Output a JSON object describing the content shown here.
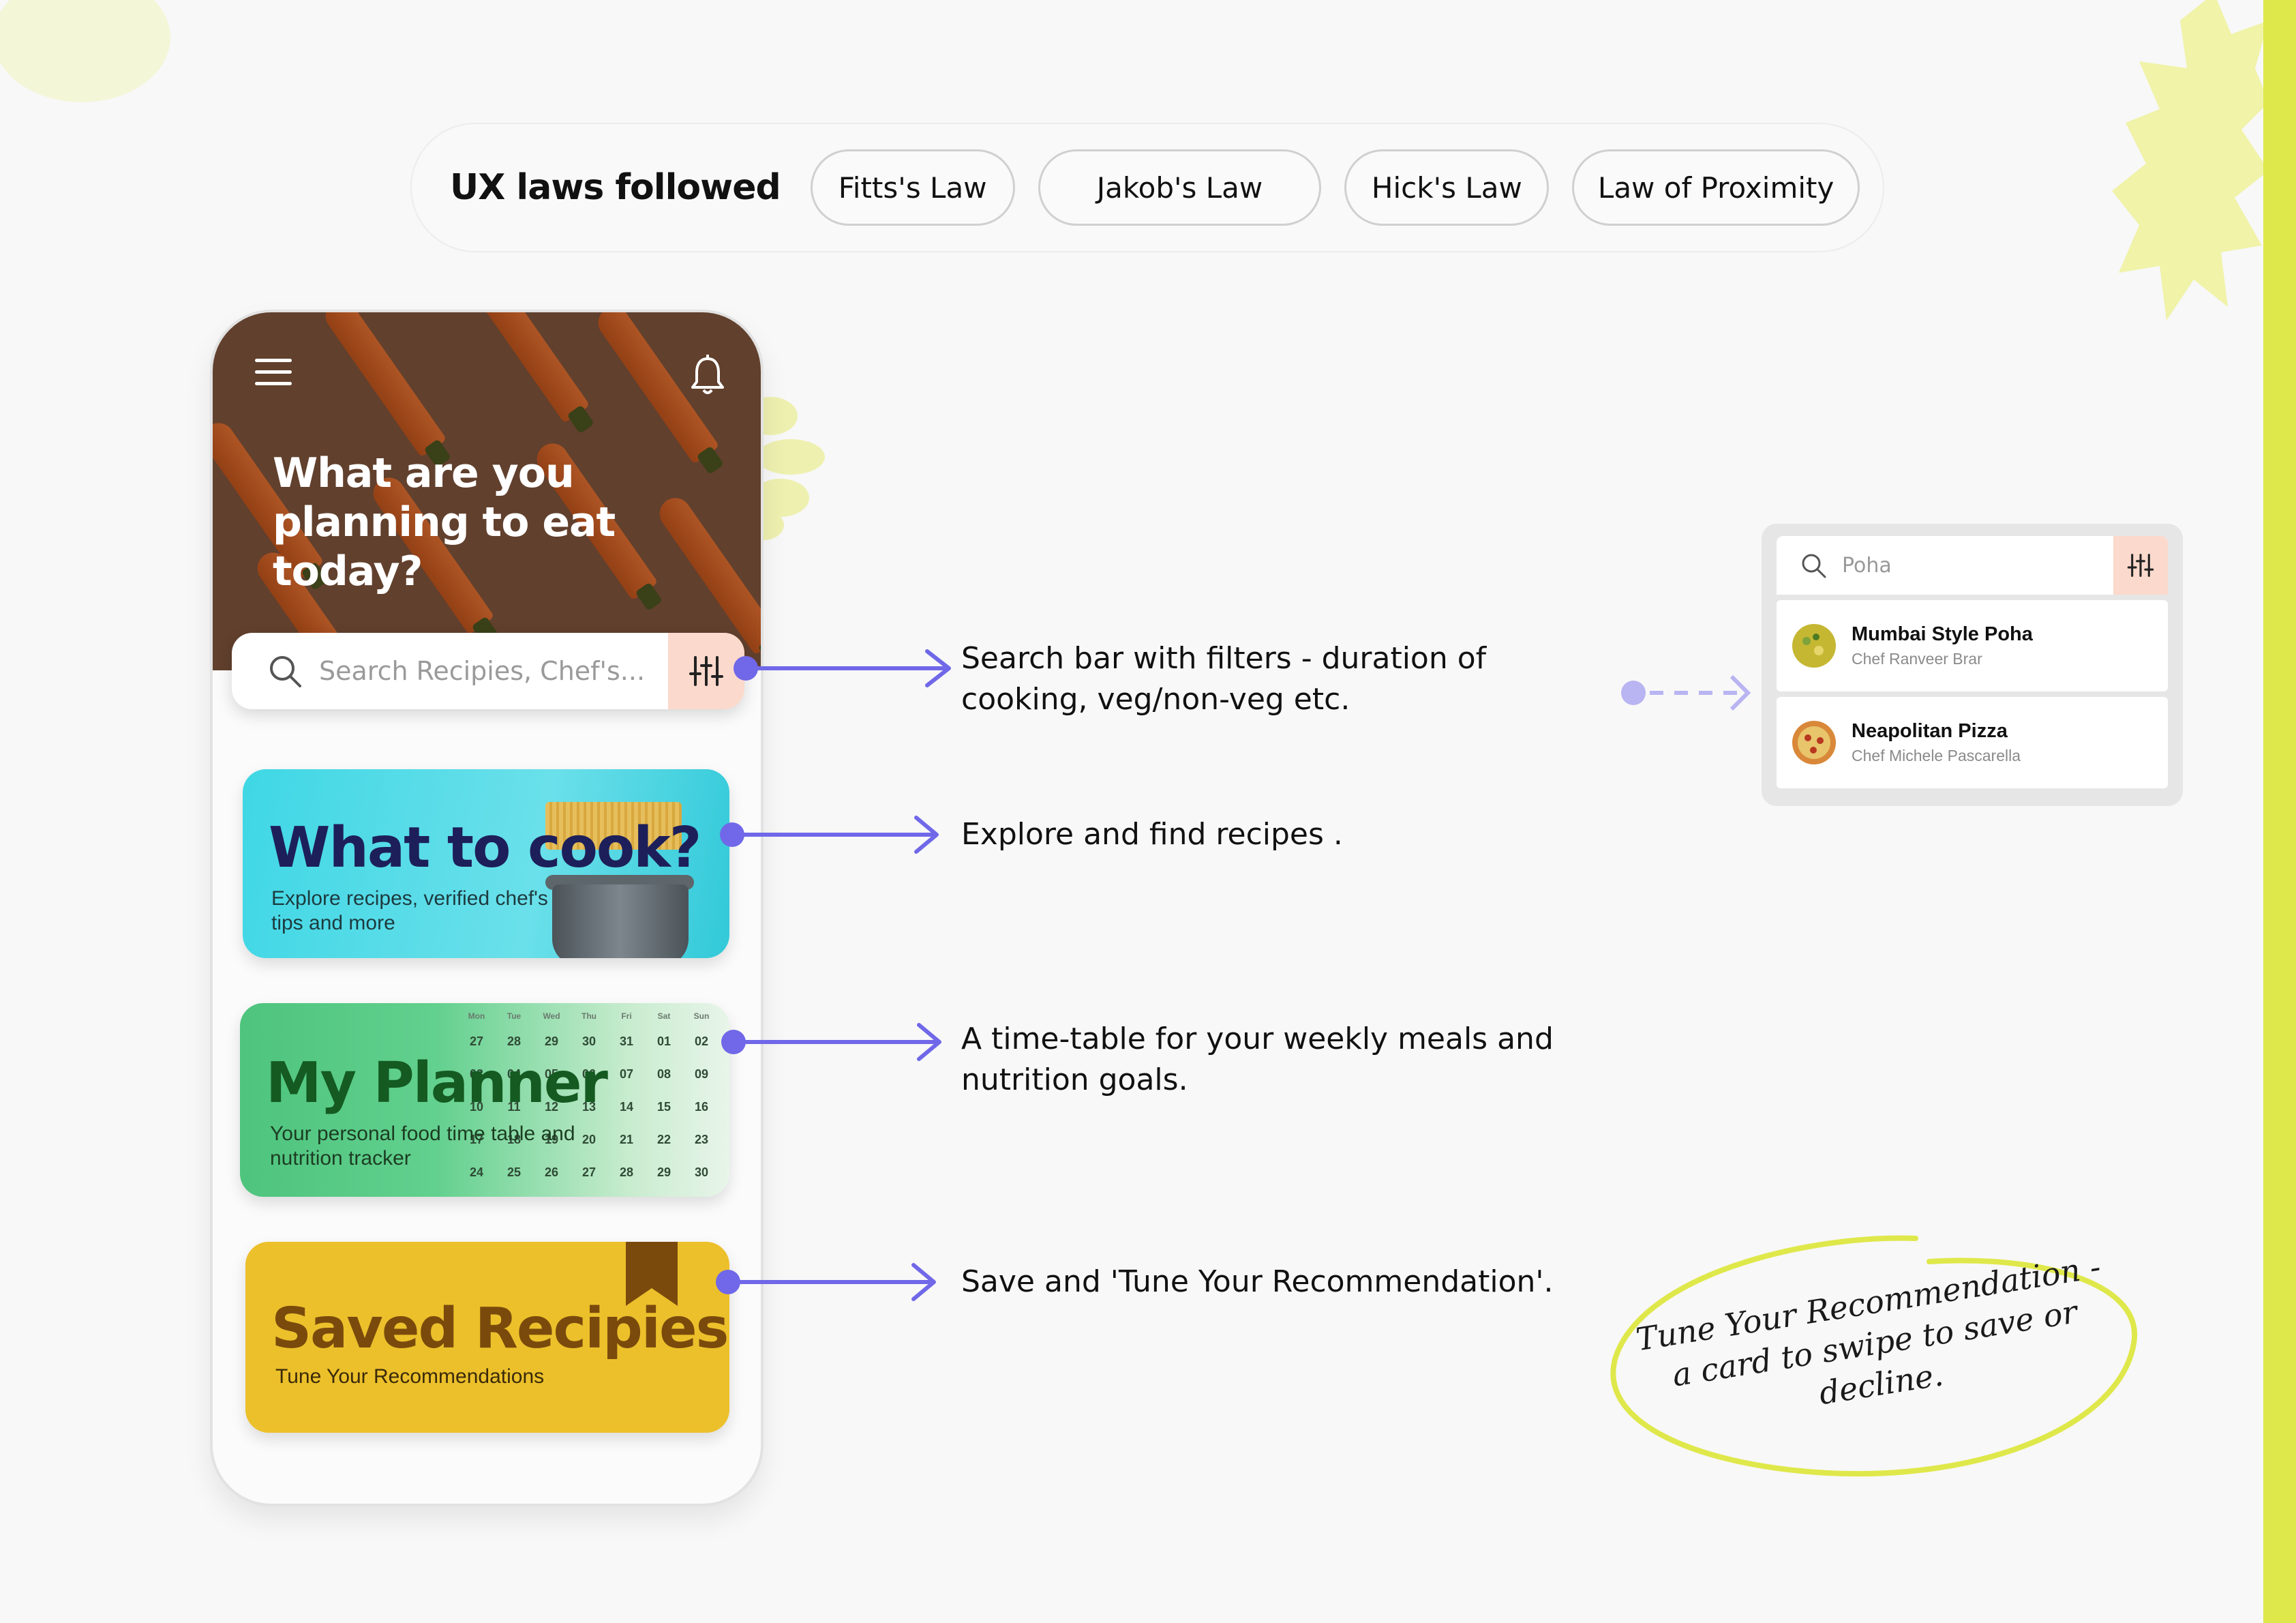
{
  "ux_laws": {
    "title": "UX laws followed",
    "items": [
      "Fitts's Law",
      "Jakob's Law",
      "Hick's Law",
      "Law of Proximity"
    ]
  },
  "phone": {
    "hero_title": "What are you planning to eat today?",
    "search_placeholder": "Search Recipies, Chef's...",
    "cards": {
      "cook": {
        "title": "What to cook?",
        "subtitle": "Explore recipes, verified chef's tips and more"
      },
      "planner": {
        "title": "My Planner",
        "subtitle": "Your personal food time table and nutrition tracker"
      },
      "saved": {
        "title": "Saved Recipies",
        "subtitle": "Tune Your Recommendations"
      }
    },
    "calendar": {
      "weekdays": [
        "Mon",
        "Tue",
        "Wed",
        "Thu",
        "Fri",
        "Sat",
        "Sun"
      ],
      "weeks": [
        [
          "27",
          "28",
          "29",
          "30",
          "31",
          "01",
          "02"
        ],
        [
          "03",
          "04",
          "05",
          "06",
          "07",
          "08",
          "09"
        ],
        [
          "10",
          "11",
          "12",
          "13",
          "14",
          "15",
          "16"
        ],
        [
          "17",
          "18",
          "19",
          "20",
          "21",
          "22",
          "23"
        ],
        [
          "24",
          "25",
          "26",
          "27",
          "28",
          "29",
          "30"
        ]
      ]
    }
  },
  "annotations": {
    "search": "Search bar with filters - duration of cooking, veg/non-veg etc.",
    "explore": "Explore and find recipes .",
    "planner": "A time-table for your weekly meals and nutrition goals.",
    "saved": "Save and 'Tune Your Recommendation'."
  },
  "mini_search": {
    "value": "Poha",
    "results": [
      {
        "name": "Mumbai Style Poha",
        "chef": "Chef Ranveer Brar"
      },
      {
        "name": "Neapolitan Pizza",
        "chef": "Chef Michele Pascarella"
      }
    ]
  },
  "tune_note": "Tune Your Recommendation - a card to swipe to save or decline.",
  "colors": {
    "accent": "#7068e8",
    "accent_light": "#b9b5f2",
    "cook_card": "#3fd7e5",
    "planner_card": "#4ec47e",
    "saved_card": "#ecc02b",
    "highlight_yellow": "#dfe84a"
  }
}
